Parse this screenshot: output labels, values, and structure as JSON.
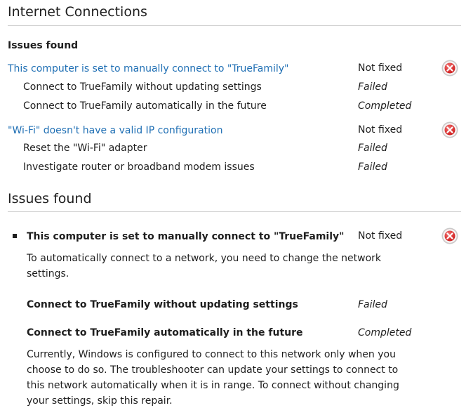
{
  "report": {
    "title": "Internet Connections",
    "summary": {
      "heading": "Issues found",
      "issues": [
        {
          "label": "This computer is set to manually connect to \"TrueFamily\"",
          "status": "Not fixed",
          "icon": "error-x-icon",
          "steps": [
            {
              "label": "Connect to TrueFamily without updating settings",
              "result": "Failed"
            },
            {
              "label": "Connect to TrueFamily automatically in the future",
              "result": "Completed"
            }
          ]
        },
        {
          "label": "\"Wi-Fi\" doesn't have a valid IP configuration",
          "status": "Not fixed",
          "icon": "error-x-icon",
          "steps": [
            {
              "label": "Reset the \"Wi-Fi\" adapter",
              "result": "Failed"
            },
            {
              "label": "Investigate router or broadband modem issues",
              "result": "Failed"
            }
          ]
        }
      ]
    },
    "details": {
      "heading": "Issues found",
      "issue": {
        "label": "This computer is set to manually connect to \"TrueFamily\"",
        "status": "Not fixed",
        "icon": "error-x-icon",
        "description": "To automatically connect to a network, you need to change the network settings.",
        "steps": [
          {
            "label": "Connect to TrueFamily without updating settings",
            "result": "Failed"
          },
          {
            "label": "Connect to TrueFamily automatically in the future",
            "result": "Completed",
            "description": "Currently, Windows is configured to connect to this network only when you choose to do so. The troubleshooter can update your settings to connect to this network automatically when it is in range. To connect without changing your settings, skip this repair."
          }
        ]
      }
    },
    "colors": {
      "link": "#1f6fb4",
      "rule": "#cfcfcf",
      "error": "#d42424"
    }
  }
}
